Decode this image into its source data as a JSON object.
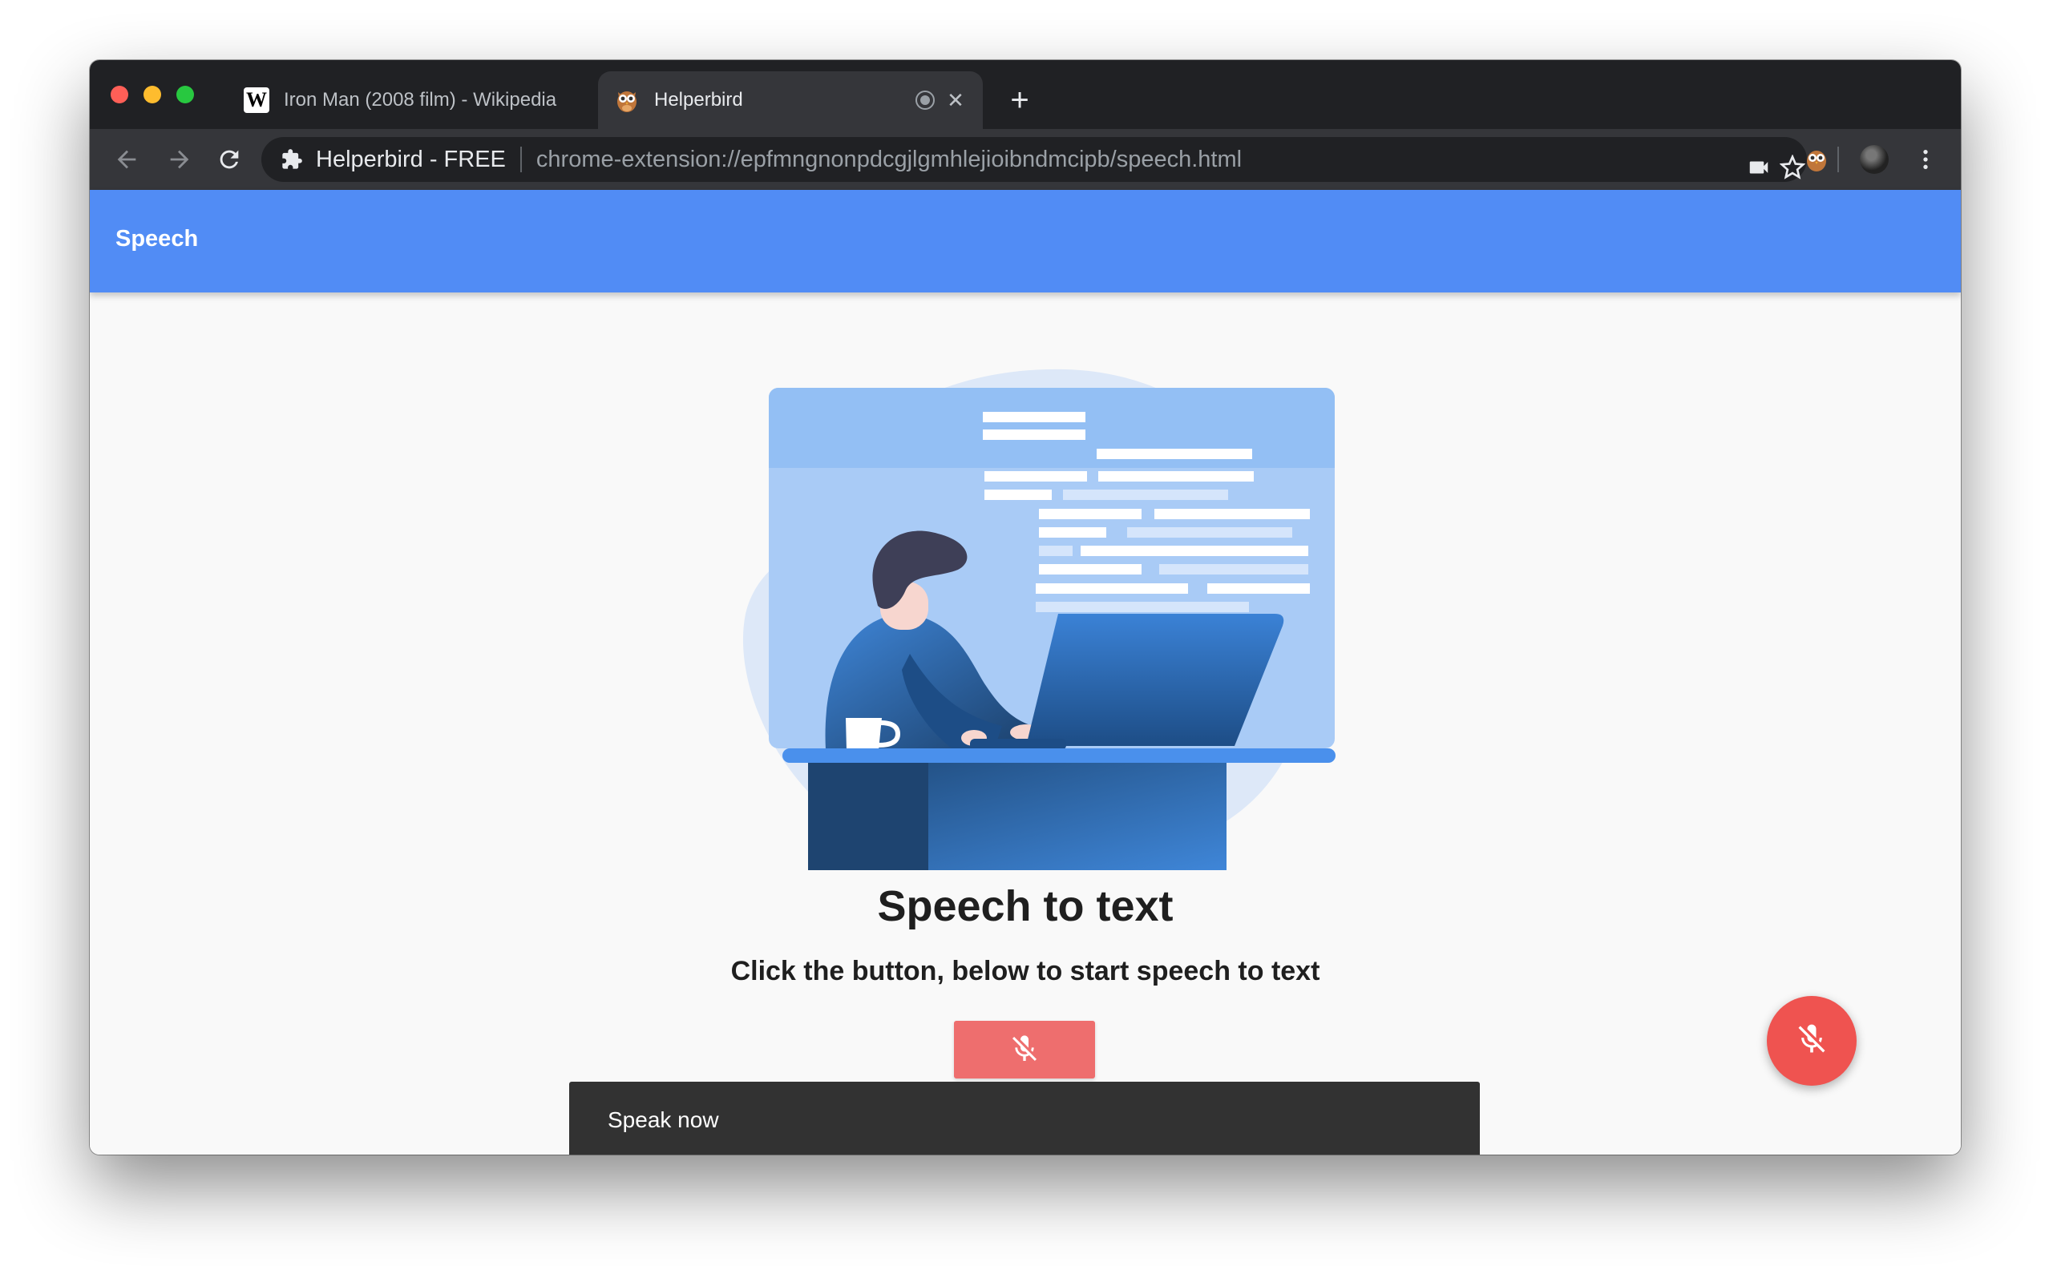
{
  "browser": {
    "tabs": [
      {
        "title": "Iron Man (2008 film) - Wikipedia",
        "favicon": "wikipedia-icon",
        "active": false
      },
      {
        "title": "Helperbird",
        "favicon": "owl-icon",
        "active": true
      }
    ],
    "omnibox": {
      "site_label": "Helperbird - FREE",
      "url": "chrome-extension://epfmngnonpdcgjlgmhlejioibndmcipb/speech.html"
    }
  },
  "appbar": {
    "title": "Speech"
  },
  "main": {
    "heading": "Speech to text",
    "subheading": "Click the button, below to start speech to text",
    "mic_button_icon": "mic-off-icon"
  },
  "snackbar": {
    "message": "Speak now"
  },
  "fab": {
    "icon": "mic-off-icon"
  },
  "colors": {
    "appbar": "#518cf5",
    "mic_button": "#ee6e6e",
    "fab": "#ef5350",
    "snackbar": "#323232",
    "chrome_dark": "#202124",
    "chrome_toolbar": "#35363a"
  }
}
